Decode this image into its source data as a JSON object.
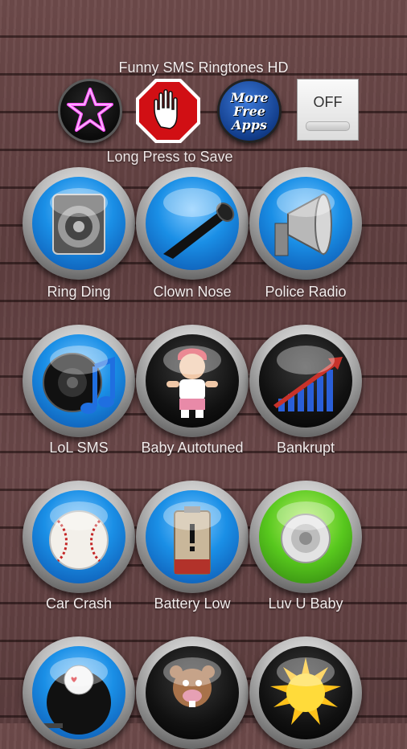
{
  "app": {
    "title": "Funny SMS Ringtones HD",
    "hint": "Long Press to Save"
  },
  "top_bar": {
    "favorites_icon": "star-icon",
    "stop_icon": "stop-hand-icon",
    "more_apps_text": "More Free Apps",
    "toggle_label": "OFF",
    "toggle_state": "off"
  },
  "sounds": [
    {
      "label": "Ring Ding",
      "icon": "speaker-icon"
    },
    {
      "label": "Clown Nose",
      "icon": "horn-icon"
    },
    {
      "label": "Police Radio",
      "icon": "loudspeaker-icon"
    },
    {
      "label": "LoL SMS",
      "icon": "speaker-music-note-icon"
    },
    {
      "label": "Baby Autotuned",
      "icon": "baby-icon"
    },
    {
      "label": "Bankrupt",
      "icon": "bar-chart-arrow-icon"
    },
    {
      "label": "Car Crash",
      "icon": "baseball-icon"
    },
    {
      "label": "Battery Low",
      "icon": "battery-warning-icon"
    },
    {
      "label": "Luv U Baby",
      "icon": "speaker-icon"
    },
    {
      "label": "",
      "icon": "bike-bell-icon"
    },
    {
      "label": "",
      "icon": "beaver-icon"
    },
    {
      "label": "",
      "icon": "sun-icon"
    }
  ],
  "colors": {
    "button_face_blue": "#1a8fe6",
    "stop_red": "#d10f14",
    "label_text": "#f1ebeb"
  }
}
